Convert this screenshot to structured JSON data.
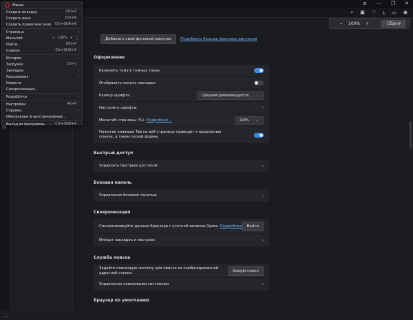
{
  "menu": {
    "title": "Меню",
    "items": [
      {
        "label": "Создать вкладку",
        "shortcut": "Ctrl+T"
      },
      {
        "label": "Создать окно",
        "shortcut": "Ctrl+N"
      },
      {
        "label": "Создать приватное окно",
        "shortcut": "Ctrl+Shift+N"
      },
      {
        "label": "Страница"
      },
      {
        "label": "Масштаб",
        "zoom_minus": "−",
        "zoom_value": "100%",
        "zoom_plus": "+",
        "zoom_full": "⛶"
      },
      {
        "label": "Найти...",
        "shortcut": "Ctrl+F"
      },
      {
        "label": "Снимок",
        "shortcut": "Ctrl+Shift+5"
      },
      {
        "label": "История"
      },
      {
        "label": "Загрузки",
        "shortcut": "Ctrl+J"
      },
      {
        "label": "Закладки"
      },
      {
        "label": "Расширения"
      },
      {
        "label": "Новости"
      },
      {
        "label": "Синхронизация..."
      },
      {
        "label": "Разработка"
      },
      {
        "label": "Настройки",
        "shortcut": "Alt+P"
      },
      {
        "label": "Справка"
      },
      {
        "label": "Обновление & восстановление..."
      },
      {
        "label": "Выход из программы",
        "shortcut": "Ctrl+Shift+X"
      }
    ]
  },
  "zoom_popup": {
    "minus": "−",
    "value": "100%",
    "plus": "+",
    "reset": "Сброс"
  },
  "wallpaper": {
    "button": "Добавить свой фоновый рисунок",
    "link": "Подобрать больше фоновых рисунков"
  },
  "sections": {
    "appearance": {
      "title": "Оформление",
      "dark_theme": "Включить тему в темных тонах",
      "bookmarks_bar": "Отобразить панель закладок",
      "font_size": "Размер шрифта",
      "font_size_value": "Средний (рекомендуется)",
      "customize_fonts": "Настроить шрифты",
      "page_zoom": "Масштаб страницы (%):",
      "page_zoom_link": "Подробнее...",
      "page_zoom_value": "100%",
      "tab_highlight": "Нажатие клавиши Tab на веб-странице приводит к выделению ссылок, а также полей формы"
    },
    "quick_access": {
      "title": "Быстрый доступ",
      "manage": "Управлять Быстрым доступом"
    },
    "sidebar": {
      "title": "Боковая панель",
      "manage": "Управление боковой панелью"
    },
    "sync": {
      "title": "Синхронизация",
      "sync_text": "Синхронизируйте данные браузера с учетной записью Opera.",
      "sync_link": "Подробнее...",
      "login": "Войти",
      "import": "Импорт закладок и настроек"
    },
    "search": {
      "title": "Служба поиска",
      "default_text": "Задайте поисковую систему для поиска из комбинированной адресной строки",
      "default_value": "Google поиск",
      "manage": "Управление поисковыми системами"
    },
    "default_browser": {
      "title": "Браузер по умолчанию"
    }
  },
  "colors": {
    "accent": "#3a8be8",
    "link": "#6fb6ff",
    "opera_red": "#ff1b2d"
  }
}
